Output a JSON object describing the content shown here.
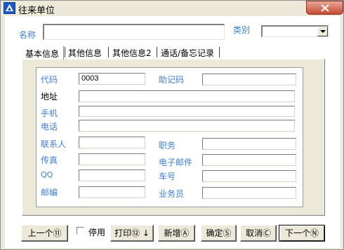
{
  "window": {
    "title": "往来单位",
    "close_icon": "close-icon"
  },
  "header": {
    "name_label": "名称",
    "name_value": "",
    "category_label": "类别",
    "category_value": ""
  },
  "tabs": [
    {
      "label": "基本信息",
      "active": true
    },
    {
      "label": "其他信息",
      "active": false
    },
    {
      "label": "其他信息2",
      "active": false
    },
    {
      "label": "通话/备忘记录",
      "active": false
    }
  ],
  "form": {
    "code_label": "代码",
    "code_value": "0003",
    "mnemonic_label": "助记码",
    "mnemonic_value": "",
    "address_label": "地址",
    "address_value": "",
    "mobile_label": "手机",
    "mobile_value": "",
    "phone_label": "电话",
    "phone_value": "",
    "contact_label": "联系人",
    "contact_value": "",
    "position_label": "职务",
    "position_value": "",
    "fax_label": "传真",
    "fax_value": "",
    "email_label": "电子邮件",
    "email_value": "",
    "qq_label": "QQ",
    "qq_value": "",
    "car_label": "车号",
    "car_value": "",
    "postcode_label": "邮编",
    "postcode_value": "",
    "salesman_label": "业务员",
    "salesman_value": ""
  },
  "footer": {
    "prev_label": "上一个⑪",
    "disable_label": "停用",
    "print_label": "打印⑫ ↓",
    "new_label": "新增Ⓐ",
    "ok_label": "确定Ⓢ",
    "cancel_label": "取消Ⓒ",
    "next_label": "下一个Ⓝ"
  },
  "colors": {
    "label_blue": "#3b7fd6",
    "window_bg": "#ece9d8",
    "title_icon": "#1d57c8",
    "close_red": "#c64b33"
  }
}
